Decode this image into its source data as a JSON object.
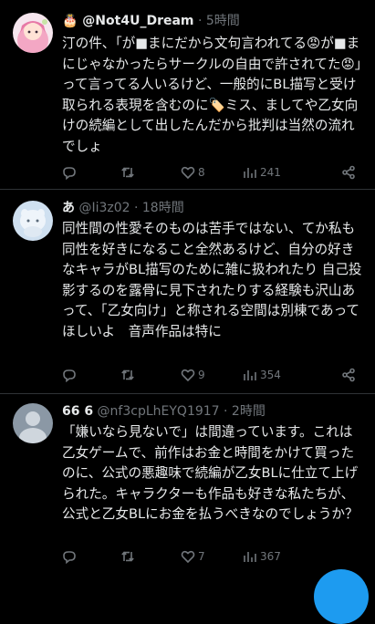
{
  "tweets": [
    {
      "name": "🎂 @Not4U_Dream",
      "handle_time": " · 5時間",
      "text": "汀の件、「が■まにだから文句言われてる😡が■まにじゃなかったらサークルの自由で許されてた😡」って言ってる人いるけど、一般的にBL描写と受け取られる表現を含むのに🏷️ミス、ましてや乙女向けの続編として出したんだから批判は当然の流れでしょ",
      "replies": "",
      "retweets": "",
      "likes": "8",
      "views": "241"
    },
    {
      "name": "あ",
      "handle_time": " @Ii3z02 · 18時間",
      "text": "同性間の性愛そのものは苦手ではない、てか私も同性を好きになること全然あるけど、自分の好きなキャラがBL描写のために雑に扱われたり 自己投影するのを露骨に見下されたりする経験も沢山あって、「乙女向け」と称される空間は別棟であってほしいよ　音声作品は特に",
      "replies": "",
      "retweets": "",
      "likes": "9",
      "views": "354"
    },
    {
      "name": "66 6",
      "handle_time": " @nf3cpLhEYQ1917 · 2時間",
      "text": "「嫌いなら見ないで」は間違っています。これは乙女ゲームで、前作はお金と時間をかけて買ったのに、公式の悪趣味で続編が乙女BLに仕立て上げられた。キャラクターも作品も好きな私たちが、公式と乙女BLにお金を払うべきなのでしょうか？",
      "replies": "",
      "retweets": "",
      "likes": "7",
      "views": "367"
    }
  ]
}
